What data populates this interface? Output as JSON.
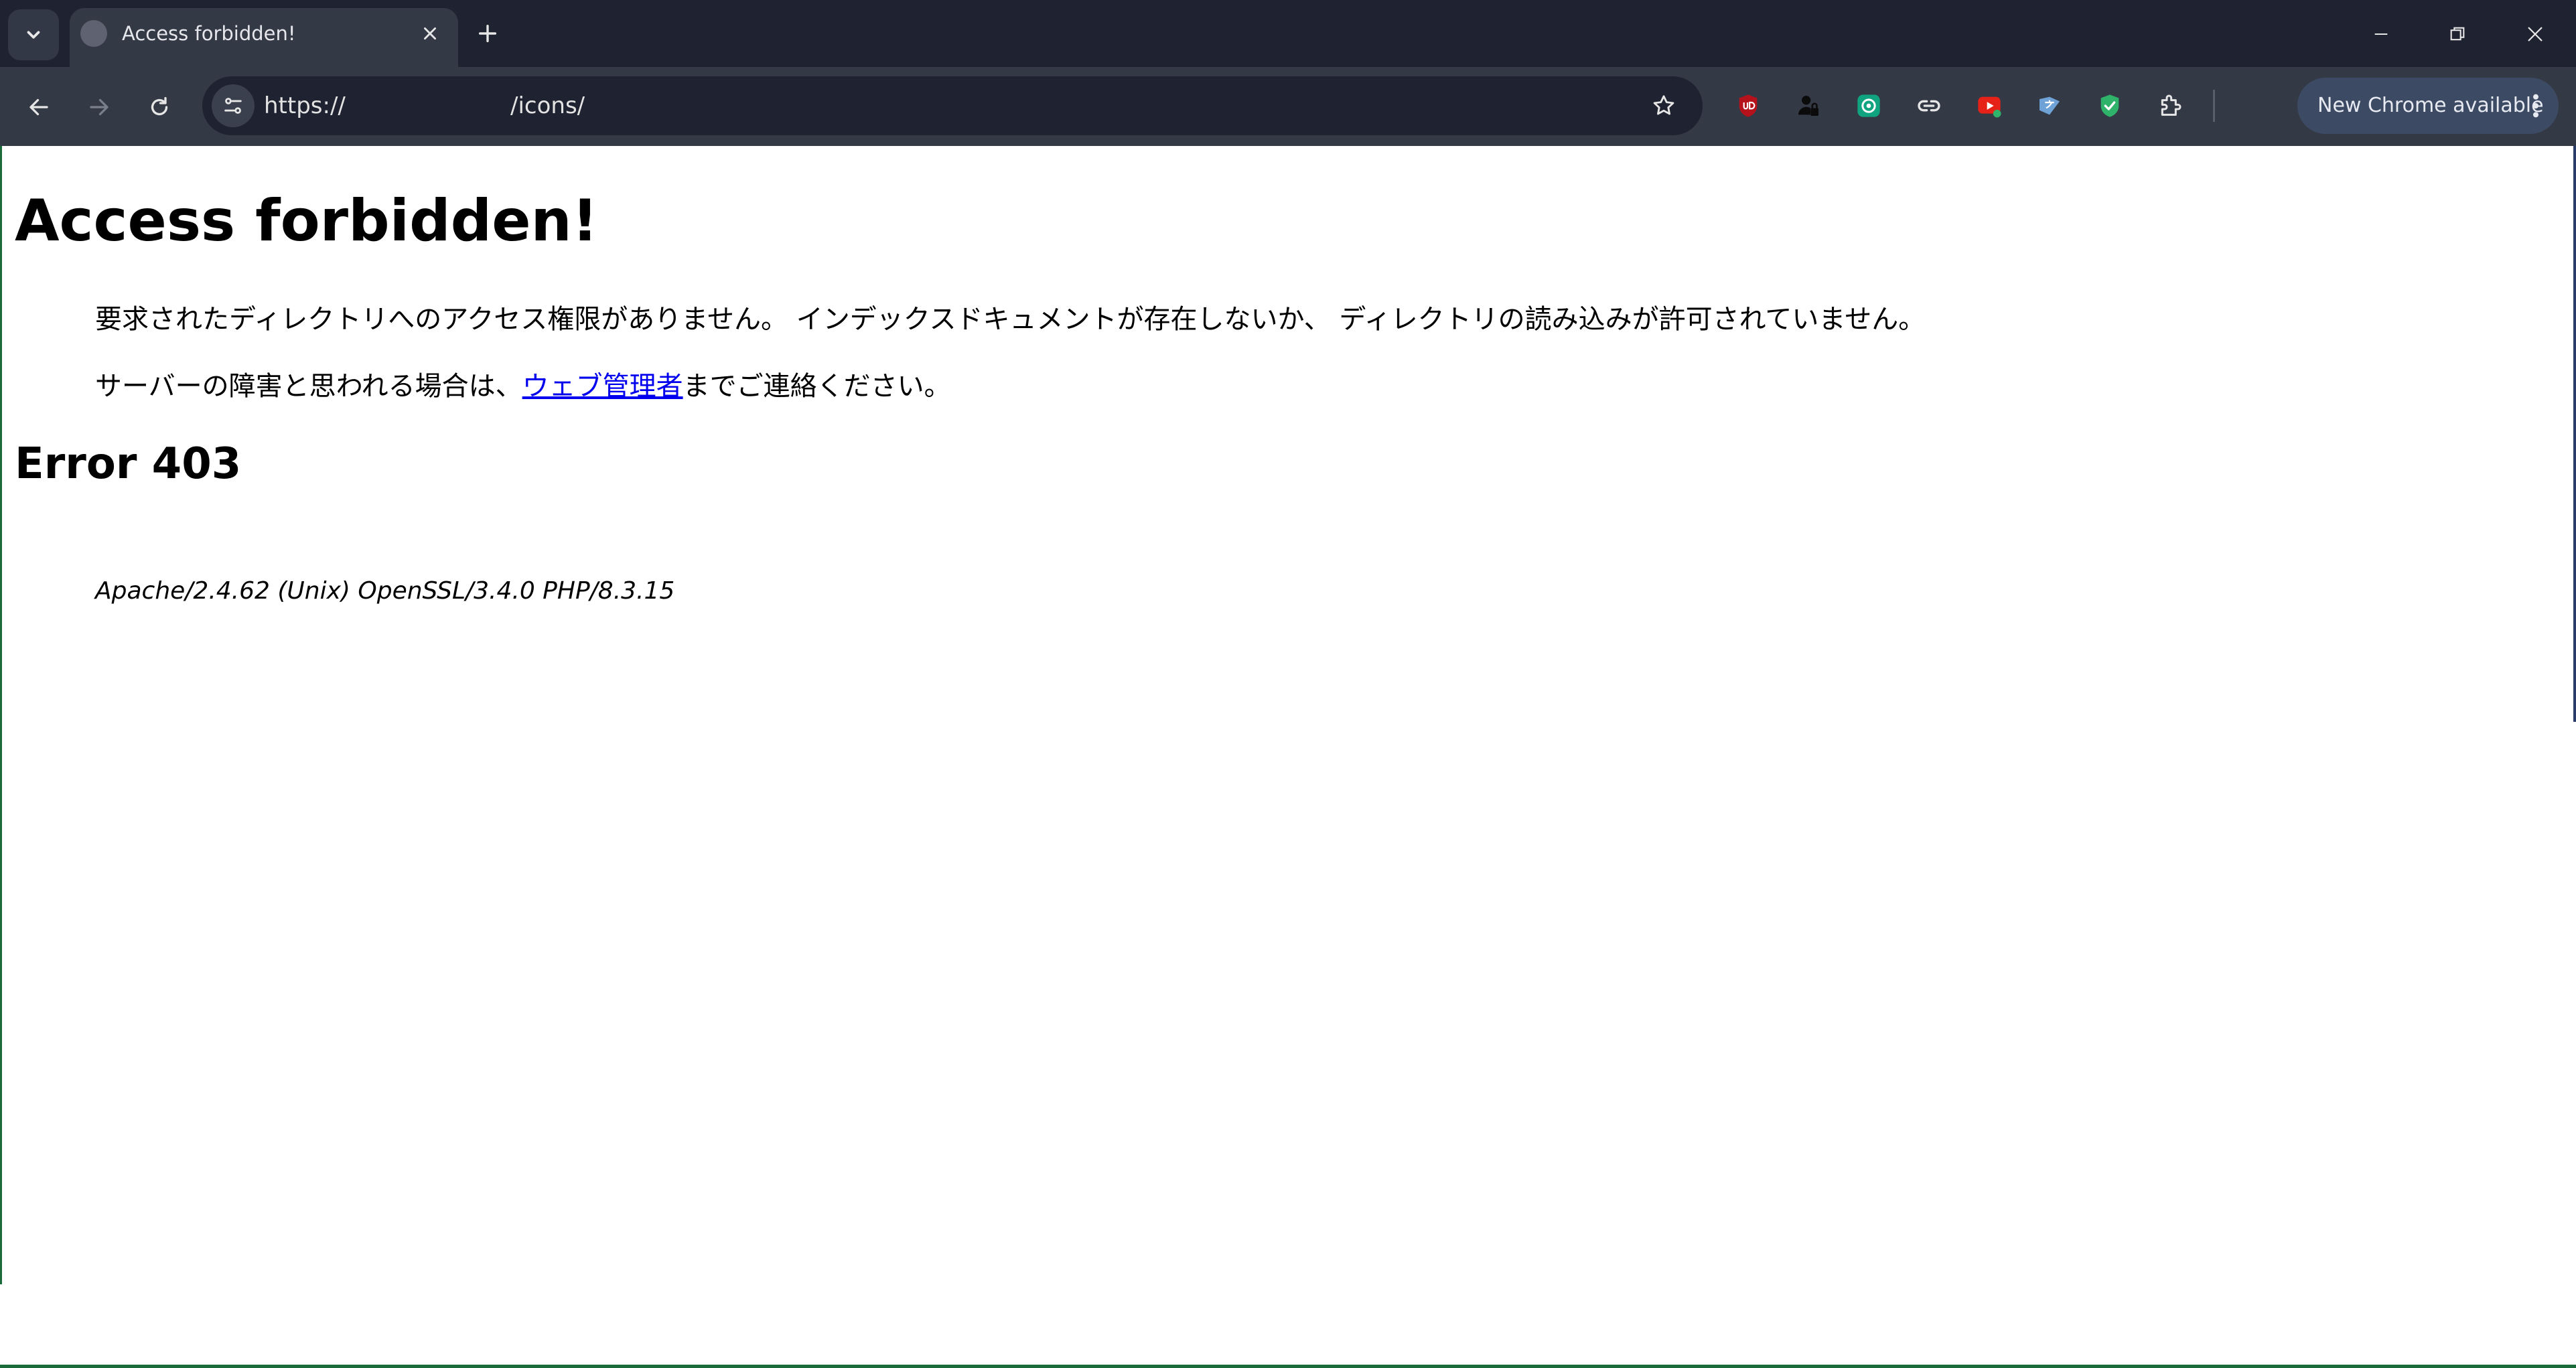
{
  "browser": {
    "tab": {
      "title": "Access forbidden!"
    },
    "address": {
      "scheme": "https://",
      "path": "/icons/"
    },
    "update_button_label": "New Chrome available",
    "icons": {
      "tab_search": "chevron-down-icon",
      "tab_close": "close-icon",
      "new_tab": "plus-icon",
      "back": "back-arrow-icon",
      "forward": "forward-arrow-icon",
      "reload": "reload-icon",
      "site_info": "tune-icon",
      "bookmark": "star-icon",
      "minimize": "minimize-icon",
      "restore": "restore-icon",
      "close": "close-icon",
      "menu": "more-vert-icon"
    },
    "extensions": [
      {
        "name": "ublock-origin",
        "color": "#b5121b"
      },
      {
        "name": "password-manager",
        "color": "#111111"
      },
      {
        "name": "chatgpt",
        "color": "#10a37f"
      },
      {
        "name": "link",
        "color": "#e6e6e6"
      },
      {
        "name": "youtube",
        "color": "#e62117"
      },
      {
        "name": "translate",
        "color": "#6fa3d8"
      },
      {
        "name": "shield-check",
        "color": "#2fb26a"
      },
      {
        "name": "extensions-puzzle",
        "color": "#e6e6e6"
      }
    ]
  },
  "page": {
    "h1": "Access forbidden!",
    "paragraph1": "要求されたディレクトリへのアクセス権限がありません。 インデックスドキュメントが存在しないか、 ディレクトリの読み込みが許可されていません。",
    "paragraph2_before": "サーバーの障害と思われる場合は、",
    "admin_link": "ウェブ管理者",
    "paragraph2_after": "までご連絡ください。",
    "h2": "Error 403",
    "signature": "Apache/2.4.62 (Unix) OpenSSL/3.4.0 PHP/8.3.15",
    "link_color": "#0000ee"
  }
}
